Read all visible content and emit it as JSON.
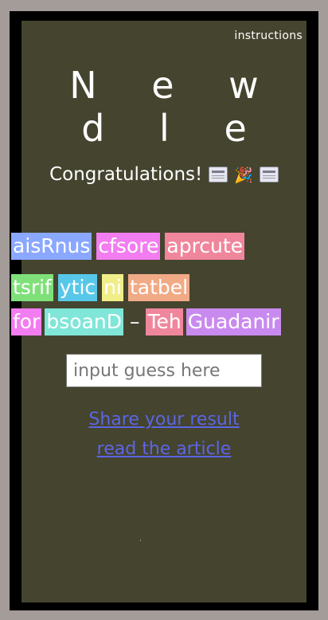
{
  "header": {
    "instructions_label": "instructions",
    "title": "N e w d l e"
  },
  "status": {
    "message": "Congratulations!",
    "emoji": [
      "newspaper-icon",
      "party-popper-icon",
      "newspaper-icon"
    ]
  },
  "words": [
    [
      {
        "text": "aisRnus",
        "color": "#8aa8ff"
      },
      {
        "text": "cfsore",
        "color": "#f27df0"
      },
      {
        "text": "aprcute",
        "color": "#f0869c"
      }
    ],
    [
      {
        "text": "tsrif",
        "color": "#7fe07a"
      },
      {
        "text": "ytic",
        "color": "#58c8ea"
      },
      {
        "text": "ni",
        "color": "#f0ee88"
      },
      {
        "text": "tatbel",
        "color": "#f1aa86"
      }
    ],
    [
      {
        "text": "for",
        "color": "#f27df0"
      },
      {
        "text": "bsoanD",
        "color": "#7fe6d8"
      },
      {
        "text": "–",
        "color": "transparent"
      },
      {
        "text": "Teh",
        "color": "#f0869c"
      },
      {
        "text": "Guadanir",
        "color": "#c98af0"
      }
    ]
  ],
  "guess": {
    "placeholder": "input guess here",
    "value": ""
  },
  "links": {
    "share": "Share your result ",
    "article": "read the article"
  }
}
